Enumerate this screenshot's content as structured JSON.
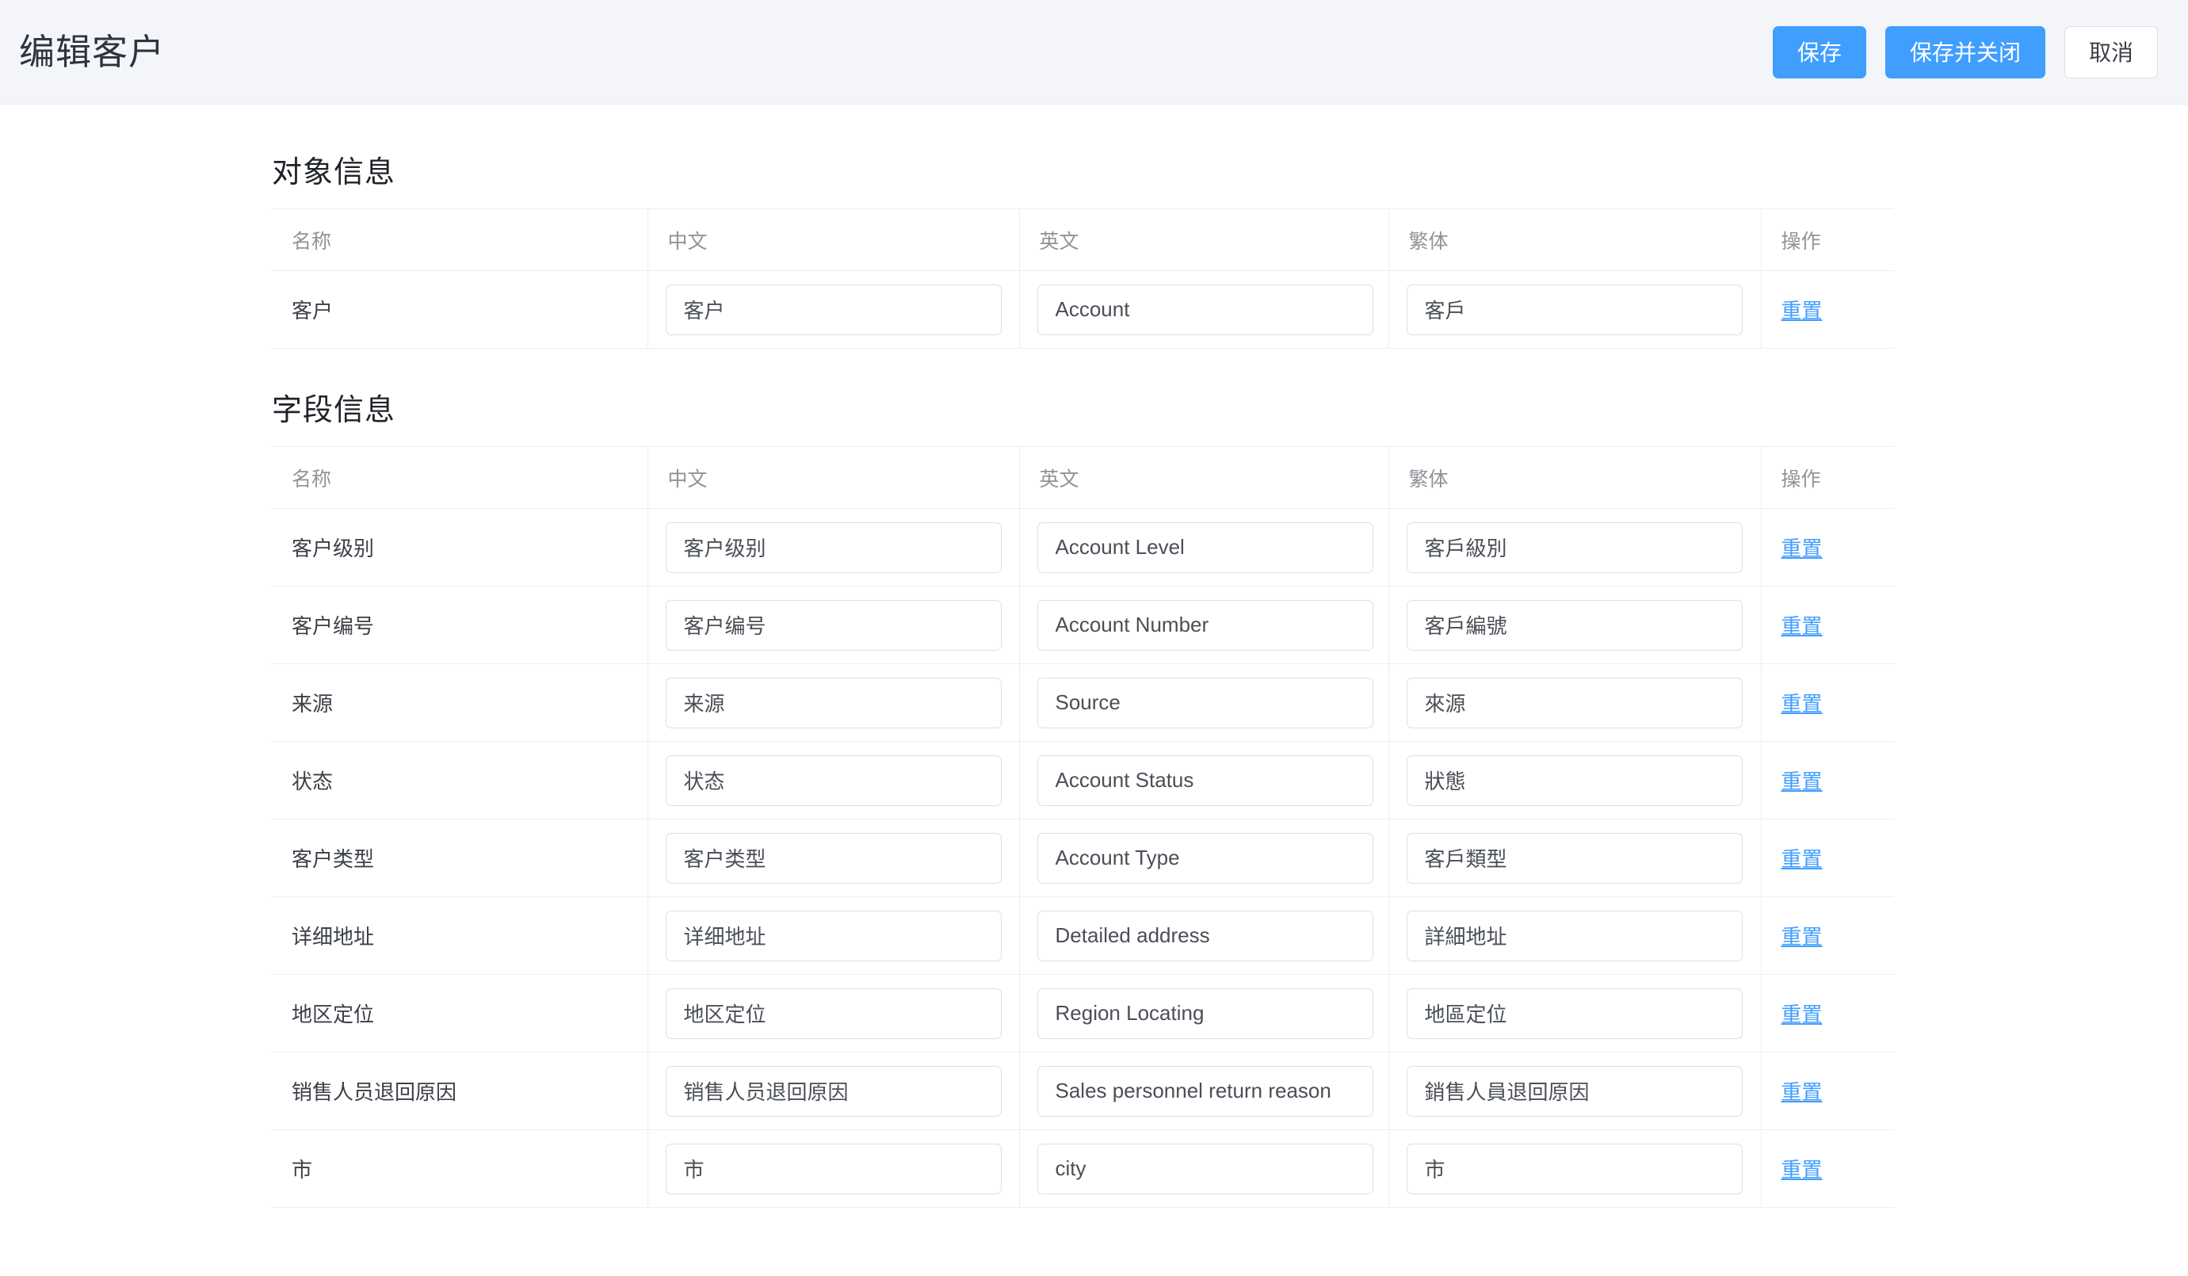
{
  "header": {
    "title": "编辑客户",
    "buttons": [
      {
        "label": "保存",
        "style": "primary",
        "name": "save-button"
      },
      {
        "label": "保存并关闭",
        "style": "primary",
        "name": "save-and-close-button"
      },
      {
        "label": "取消",
        "style": "default",
        "name": "cancel-button"
      }
    ]
  },
  "colors": {
    "primary": "#409eff",
    "header_bg": "#f4f5f9",
    "border": "#ebeef5",
    "input_border": "#dcdfe6",
    "muted_text": "#909399"
  },
  "columns": {
    "name": "名称",
    "zh": "中文",
    "en": "英文",
    "tw": "繁体",
    "op": "操作"
  },
  "action_label": "重置",
  "object_section": {
    "title": "对象信息",
    "rows": [
      {
        "name": "客户",
        "zh": "客户",
        "en": "Account",
        "tw": "客戶",
        "action": "重置"
      }
    ]
  },
  "field_section": {
    "title": "字段信息",
    "rows": [
      {
        "name": "客户级别",
        "zh": "客户级别",
        "en": "Account Level",
        "tw": "客戶級別",
        "action": "重置"
      },
      {
        "name": "客户编号",
        "zh": "客户编号",
        "en": "Account Number",
        "tw": "客戶編號",
        "action": "重置"
      },
      {
        "name": "来源",
        "zh": "来源",
        "en": "Source",
        "tw": "來源",
        "action": "重置"
      },
      {
        "name": "状态",
        "zh": "状态",
        "en": "Account Status",
        "tw": "狀態",
        "action": "重置"
      },
      {
        "name": "客户类型",
        "zh": "客户类型",
        "en": "Account Type",
        "tw": "客戶類型",
        "action": "重置"
      },
      {
        "name": "详细地址",
        "zh": "详细地址",
        "en": "Detailed address",
        "tw": "詳細地址",
        "action": "重置"
      },
      {
        "name": "地区定位",
        "zh": "地区定位",
        "en": "Region Locating",
        "tw": "地區定位",
        "action": "重置"
      },
      {
        "name": "销售人员退回原因",
        "zh": "销售人员退回原因",
        "en": "Sales personnel return reason",
        "tw": "銷售人員退回原因",
        "action": "重置"
      },
      {
        "name": "市",
        "zh": "市",
        "en": "city",
        "tw": "市",
        "action": "重置"
      }
    ]
  }
}
